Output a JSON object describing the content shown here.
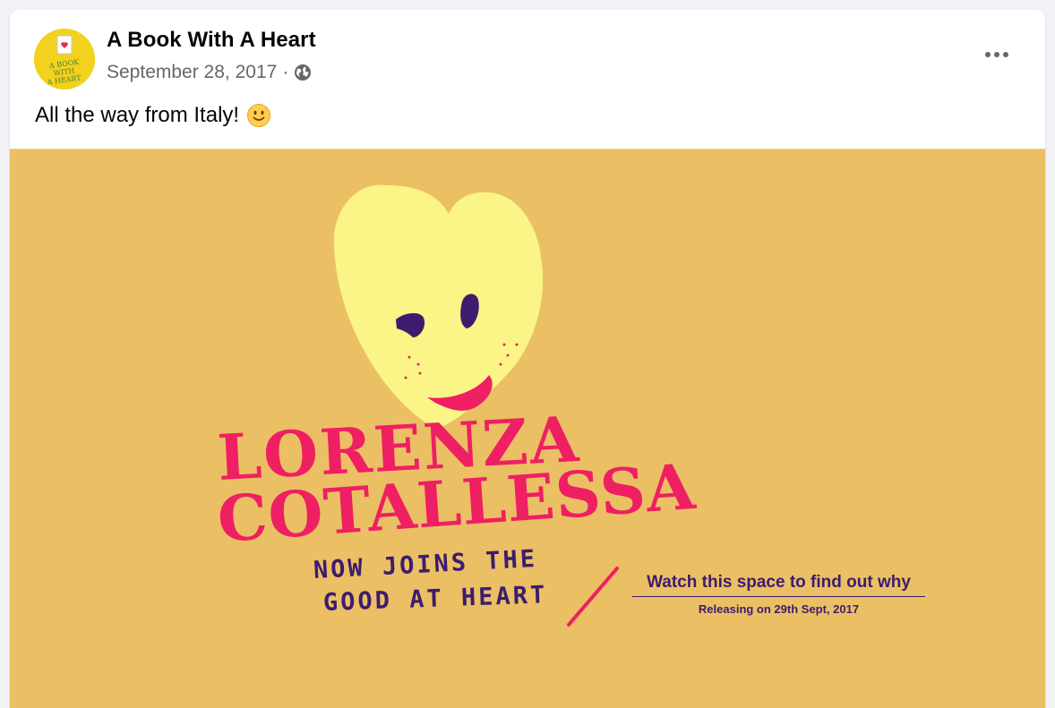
{
  "post": {
    "page_name": "A Book With A Heart",
    "date": "September 28, 2017",
    "separator": "·",
    "privacy_icon": "globe-icon",
    "more_icon": "more-options-icon",
    "caption": "All the way from Italy!",
    "caption_emoji": "slightly-smiling-face-icon"
  },
  "avatar": {
    "logo_text": "A BOOK WITH A HEART"
  },
  "image": {
    "background_color": "#ebbf64",
    "heart_color": "#fbf487",
    "name_color": "#ef1f63",
    "text_color": "#3d1c6e",
    "name_line1": "LORENZA",
    "name_line2": "COTALLESSA",
    "joins_line1": "NOW JOINS THE",
    "joins_line2": "GOOD AT HEART",
    "watch_text": "Watch this space to find out why",
    "release_text": "Releasing on 29th Sept, 2017"
  }
}
